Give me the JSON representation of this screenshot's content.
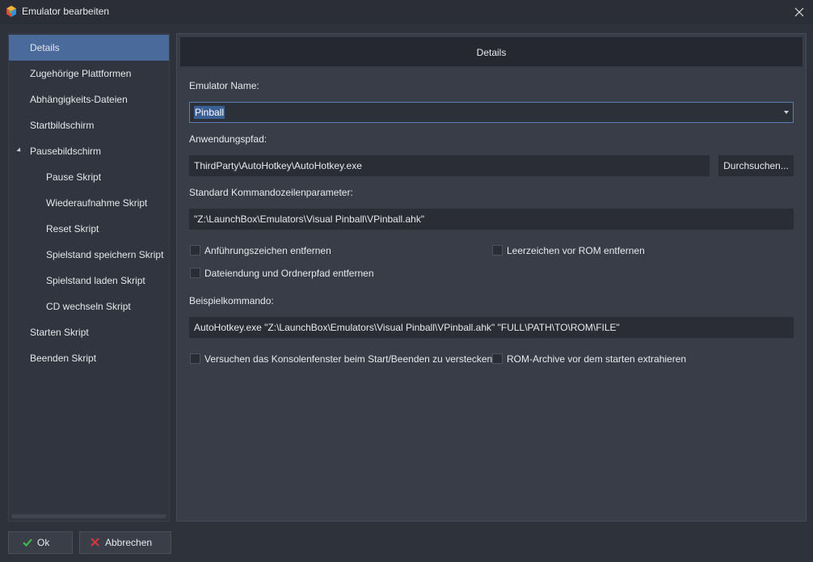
{
  "window": {
    "title": "Emulator bearbeiten"
  },
  "sidebar": {
    "items": [
      {
        "label": "Details",
        "selected": true
      },
      {
        "label": "Zugehörige Plattformen"
      },
      {
        "label": "Abhängigkeits-Dateien"
      },
      {
        "label": "Startbildschirm"
      },
      {
        "label": "Pausebildschirm",
        "expanded": true
      },
      {
        "label": "Pause Skript"
      },
      {
        "label": "Wiederaufnahme Skript"
      },
      {
        "label": "Reset Skript"
      },
      {
        "label": "Spielstand speichern Skript"
      },
      {
        "label": "Spielstand laden Skript"
      },
      {
        "label": "CD wechseln Skript"
      },
      {
        "label": "Starten Skript"
      },
      {
        "label": "Beenden Skript"
      }
    ]
  },
  "main": {
    "header": "Details",
    "emulator_name_label": "Emulator Name:",
    "emulator_name_value": "Pinball",
    "app_path_label": "Anwendungspfad:",
    "app_path_value": "ThirdParty\\AutoHotkey\\AutoHotkey.exe",
    "browse_button": "Durchsuchen...",
    "cmdline_label": "Standard Kommandozeilenparameter:",
    "cmdline_value": "\"Z:\\LaunchBox\\Emulators\\Visual Pinball\\VPinball.ahk\"",
    "checkboxes": {
      "remove_quotes": {
        "label": "Anführungszeichen entfernen",
        "checked": false
      },
      "remove_space_before_rom": {
        "label": "Leerzeichen vor ROM entfernen",
        "checked": false
      },
      "remove_extension_path": {
        "label": "Dateiendung und Ordnerpfad entfernen",
        "checked": false
      },
      "hide_console": {
        "label": "Versuchen das Konsolenfenster beim Start/Beenden zu verstecken",
        "checked": false
      },
      "extract_rom_archives": {
        "label": "ROM-Archive vor dem starten extrahieren",
        "checked": false
      }
    },
    "example_label": "Beispielkommando:",
    "example_value": "AutoHotkey.exe \"Z:\\LaunchBox\\Emulators\\Visual Pinball\\VPinball.ahk\" \"FULL\\PATH\\TO\\ROM\\FILE\""
  },
  "footer": {
    "ok_label": "Ok",
    "cancel_label": "Abbrechen"
  },
  "colors": {
    "selected": "#4a6a9c",
    "ok_icon": "#3cc24a",
    "cancel_icon": "#d9363e"
  },
  "icons": [
    "app-icon",
    "close-icon",
    "expand-arrow-icon",
    "combo-arrow-icon",
    "checkmark-icon",
    "cancel-x-icon"
  ]
}
